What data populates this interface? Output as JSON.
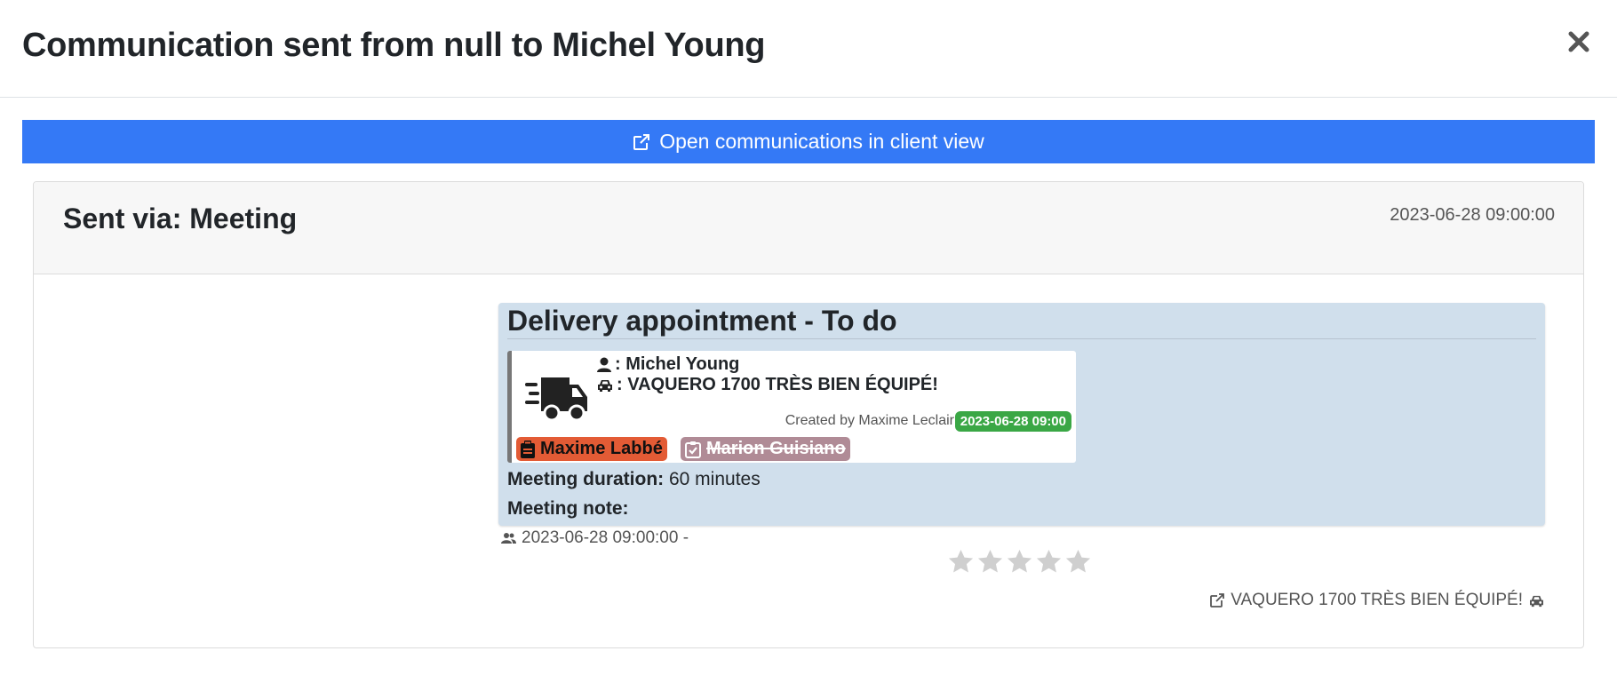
{
  "modal": {
    "title": "Communication sent from null to Michel Young"
  },
  "open_bar": {
    "label": "Open communications in client view"
  },
  "card": {
    "sent_via": "Sent via: Meeting",
    "sent_date": "2023-06-28 09:00:00"
  },
  "task": {
    "title": "Delivery appointment - To do",
    "client_name": ": Michel Young",
    "vehicle_name": ": VAQUERO 1700 TRÈS BIEN ÉQUIPÉ!",
    "created_by": "Created by Maxime Leclair",
    "created_date": "2023-06-28 09:00",
    "assignee_primary": "Maxime Labbé",
    "assignee_secondary": "Marion Guisiano",
    "duration_label": "Meeting duration:",
    "duration_value": " 60 minutes",
    "note_label": "Meeting note:",
    "note_value": ""
  },
  "footer": {
    "timestamp": "2023-06-28 09:00:00 -",
    "rating": 0,
    "rating_max": 5,
    "vehicle_link": "VAQUERO 1700 TRÈS BIEN ÉQUIPÉ!"
  },
  "icons": {
    "close": "close-icon",
    "external_link": "external-link-icon",
    "truck": "truck-icon",
    "user": "user-icon",
    "car": "car-icon",
    "clipboard": "clipboard-icon",
    "checkbox": "checkbox-icon",
    "users": "users-icon",
    "star": "star-icon"
  },
  "colors": {
    "primary": "#3479f6",
    "task_bg": "#d0dfec",
    "success": "#3aa745",
    "assignee_primary": "#e35b35",
    "assignee_secondary": "#b08b96",
    "star_empty": "#cfcfcf"
  }
}
